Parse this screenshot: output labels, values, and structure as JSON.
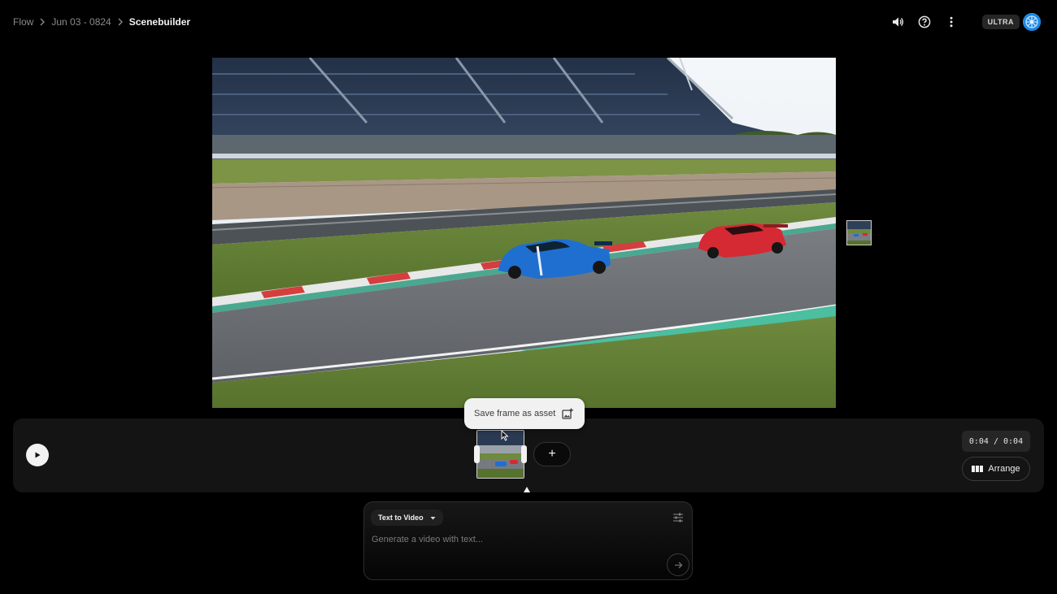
{
  "breadcrumb": {
    "items": [
      "Flow",
      "Jun 03 - 0824"
    ],
    "current": "Scenebuilder"
  },
  "topbar": {
    "icons": [
      "volume-icon",
      "help-icon",
      "more-vert-icon"
    ],
    "plan_badge": "ULTRA"
  },
  "timeline": {
    "timecode": "0:04 / 0:04",
    "arrange_label": "Arrange",
    "add_label": "+"
  },
  "tooltip": {
    "label": "Save frame as asset"
  },
  "prompt": {
    "mode": "Text to Video",
    "placeholder": "Generate a video with text..."
  },
  "colors": {
    "background": "#000000",
    "panel": "#141414",
    "avatar": "#1e88e5"
  }
}
